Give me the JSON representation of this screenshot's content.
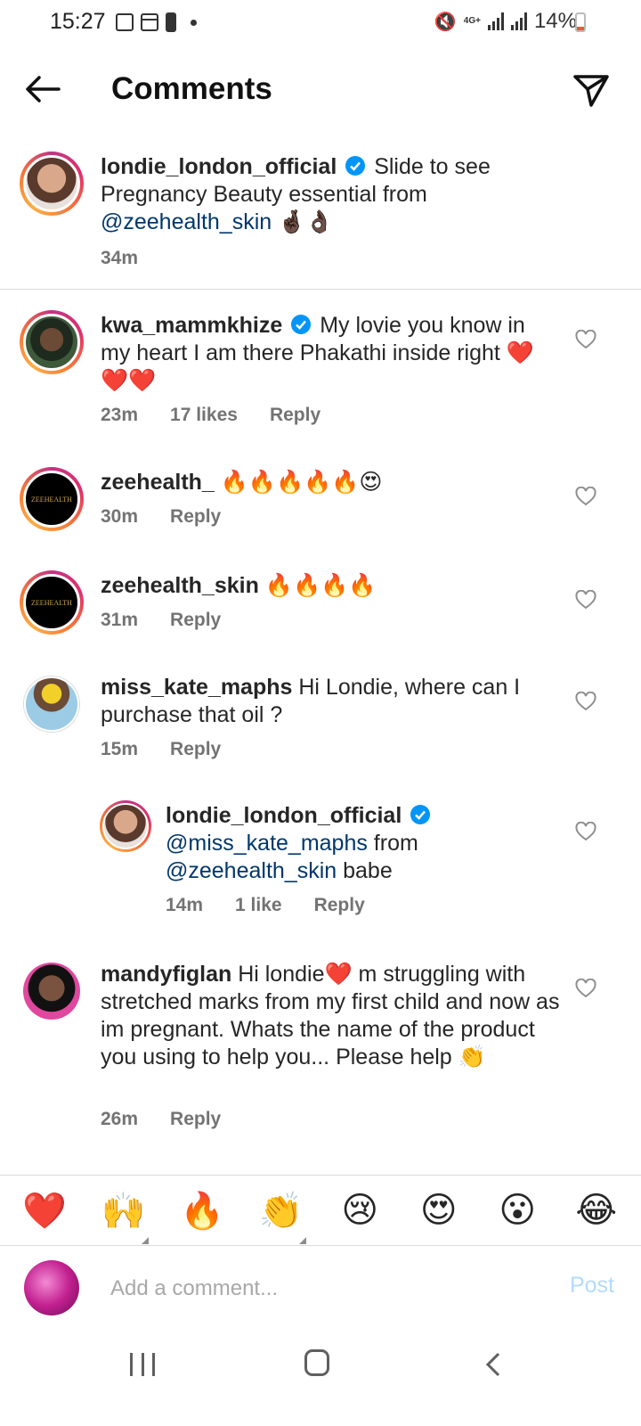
{
  "status_bar": {
    "time": "15:27",
    "network": "4G+",
    "battery": "14%"
  },
  "header": {
    "title": "Comments",
    "back_icon": "arrow-left-icon",
    "send_icon": "paper-plane-icon"
  },
  "caption": {
    "username": "londie_london_official",
    "text_before": "Slide to see Pregnancy Beauty essential from ",
    "mention": "@zeehealth_skin",
    "emoji": "🤞🏿👌🏿",
    "time": "34m"
  },
  "comments": [
    {
      "username": "kwa_mammkhize",
      "verified": true,
      "text": "My lovie you know in my heart I am there Phakathi inside right ❤️❤️❤️",
      "time": "23m",
      "likes": "17 likes",
      "reply": "Reply"
    },
    {
      "username": "zeehealth_",
      "text": "🔥🔥🔥🔥🔥😍",
      "time": "30m",
      "reply": "Reply",
      "avatar_text": "ZEEHEALTH"
    },
    {
      "username": "zeehealth_skin",
      "text": "🔥🔥🔥🔥",
      "time": "31m",
      "reply": "Reply",
      "avatar_text": "ZEEHEALTH"
    },
    {
      "username": "miss_kate_maphs",
      "text": "Hi Londie, where can I purchase that oil ?",
      "time": "15m",
      "reply": "Reply"
    },
    {
      "username": "londie_london_official",
      "verified": true,
      "mention1": "@miss_kate_maphs",
      "text_mid": " from ",
      "mention2": "@zeehealth_skin",
      "text_end": " babe",
      "time": "14m",
      "likes": "1 like",
      "reply": "Reply"
    },
    {
      "username": "mandyfiglan",
      "text": "Hi londie❤️ m struggling with stretched marks from my first child and now as im pregnant. Whats the name of the product you using to help you... Please help 👏",
      "time": "26m",
      "reply": "Reply"
    }
  ],
  "reactions": [
    "❤️",
    "🙌",
    "🔥",
    "👏",
    "😢",
    "😍",
    "😮",
    "😂"
  ],
  "composer": {
    "placeholder": "Add a comment...",
    "post_label": "Post"
  },
  "colors": {
    "mention": "#00376b",
    "meta": "#737373",
    "post_disabled": "#b3dbff",
    "verified": "#0095f6"
  }
}
